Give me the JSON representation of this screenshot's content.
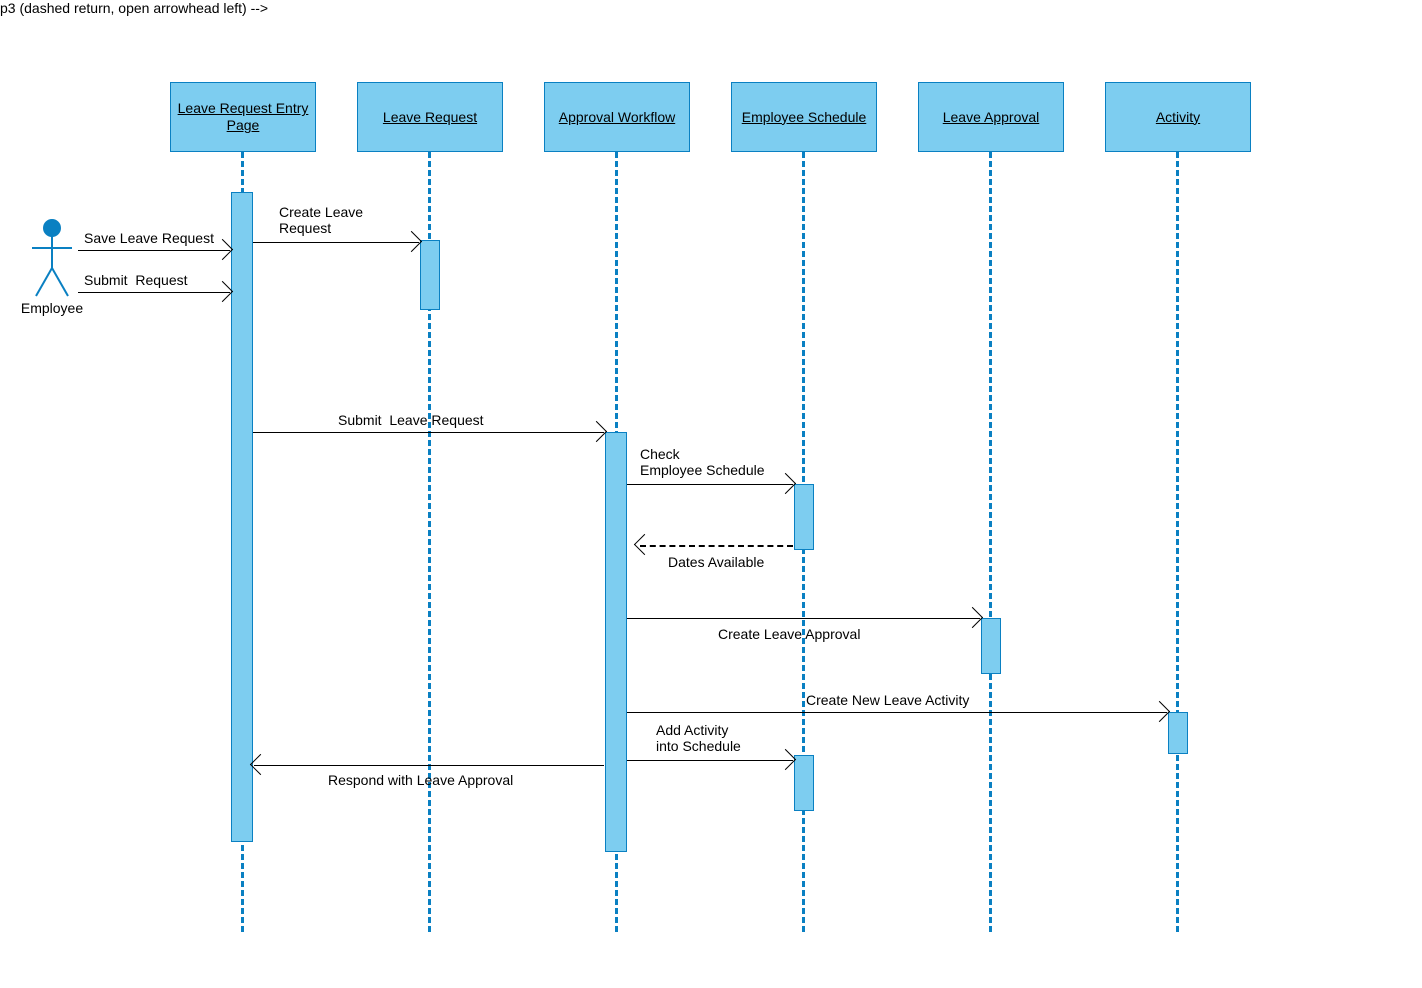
{
  "actor": {
    "label": "Employee"
  },
  "participants": [
    {
      "id": "p1",
      "label": "Leave Request\nEntry Page"
    },
    {
      "id": "p2",
      "label": "Leave Request"
    },
    {
      "id": "p3",
      "label": "Approval\nWorkflow"
    },
    {
      "id": "p4",
      "label": "Employee\nSchedule"
    },
    {
      "id": "p5",
      "label": "Leave Approval"
    },
    {
      "id": "p6",
      "label": "Activity"
    }
  ],
  "messages": {
    "save_leave_request": "Save Leave Request",
    "submit_request": "Submit  Request",
    "create_leave_request": "Create Leave\nRequest",
    "submit_leave_request": "Submit  Leave Request",
    "check_employee_schedule": "Check\nEmployee Schedule",
    "dates_available": "Dates Available",
    "create_leave_approval": "Create Leave Approval",
    "create_new_leave_activity": "Create New Leave Activity",
    "add_activity_into_schedule": "Add Activity\ninto Schedule",
    "respond_with_leave_approval": "Respond with Leave Approval"
  },
  "colors": {
    "fill": "#7dcdf0",
    "stroke": "#0a80c2"
  }
}
